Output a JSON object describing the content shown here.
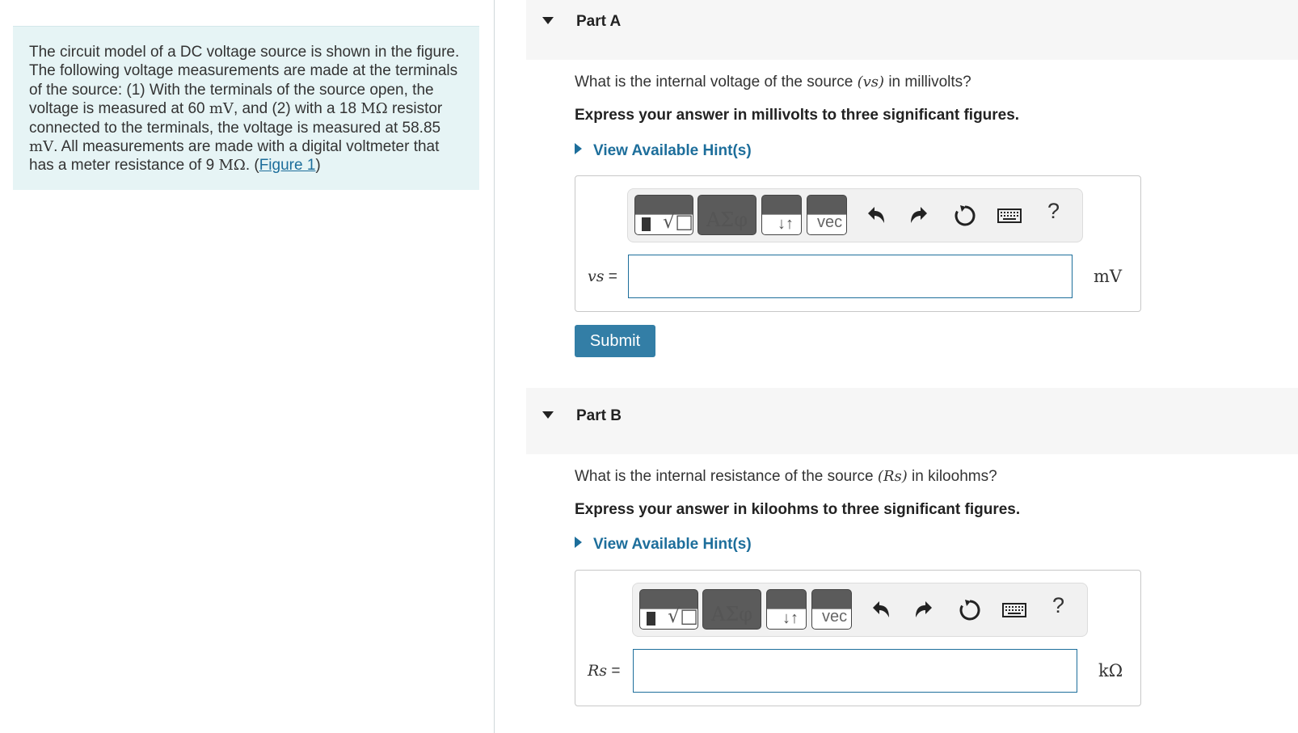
{
  "problem": {
    "intro": "The circuit model of a DC voltage source is shown in the figure. The following voltage measurements are made at the terminals of the source: (1) With the terminals of the source open, the voltage is measured at 60 ",
    "unit_mv": "mV",
    "after_60": ", and (2) with a 18 ",
    "unit_mohm": "MΩ",
    "after_18": " resistor connected to the terminals, the voltage is measured at 58.85 ",
    "unit_mv2": "mV",
    "after_5885": ". All measurements are made with a digital voltmeter that has a meter resistance of 9 ",
    "unit_mohm2": "MΩ",
    "after_9": ". (",
    "figure_link": "Figure 1",
    "close": ")"
  },
  "partA": {
    "title": "Part A",
    "question_pre": "What is the internal voltage of the source ",
    "question_var": "(vs)",
    "question_post": " in millivolts?",
    "instruction": "Express your answer in millivolts to three significant figures.",
    "hint": "View Available Hint(s)",
    "var_label": "vs",
    "eq": " =",
    "input_value": "",
    "unit": "mV",
    "submit": "Submit"
  },
  "partB": {
    "title": "Part B",
    "question_pre": "What is the internal resistance of the source ",
    "question_var": "(Rs)",
    "question_post": " in kiloohms?",
    "instruction": "Express your answer in kiloohms to three significant figures.",
    "hint": "View Available Hint(s)",
    "var_label": "Rs",
    "eq": " =",
    "input_value": "",
    "unit": "kΩ"
  },
  "toolbar": {
    "greek": "ΑΣφ",
    "arrows": "↓↑",
    "vec": "vec",
    "radical": "√□",
    "help": "?",
    "icons": [
      "templates-icon",
      "greek-icon",
      "arrows-icon",
      "vec-icon",
      "undo-icon",
      "redo-icon",
      "reset-icon",
      "keyboard-icon",
      "help-icon"
    ]
  }
}
